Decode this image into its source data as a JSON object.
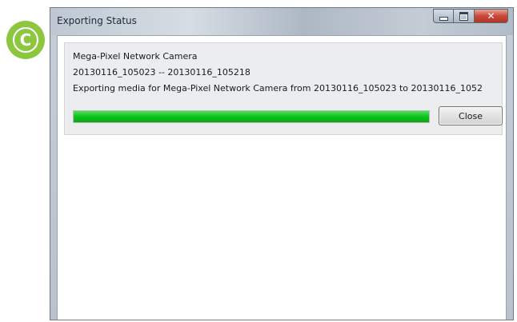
{
  "badge": {
    "letter": "C",
    "color": "#8dc63f"
  },
  "window": {
    "title": "Exporting Status",
    "controls": {
      "minimize_icon": "minimize-icon",
      "maximize_icon": "maximize-icon",
      "close_icon": "close-icon",
      "close_glyph": "✕"
    }
  },
  "export": {
    "camera_name": "Mega-Pixel Network Camera",
    "time_range": "20130116_105023 -- 20130116_105218",
    "status_message": "Exporting media for Mega-Pixel Network Camera from 20130116_105023 to 20130116_1052",
    "progress_percent": 100,
    "progress_color": "#0fc21d",
    "close_label": "Close"
  }
}
